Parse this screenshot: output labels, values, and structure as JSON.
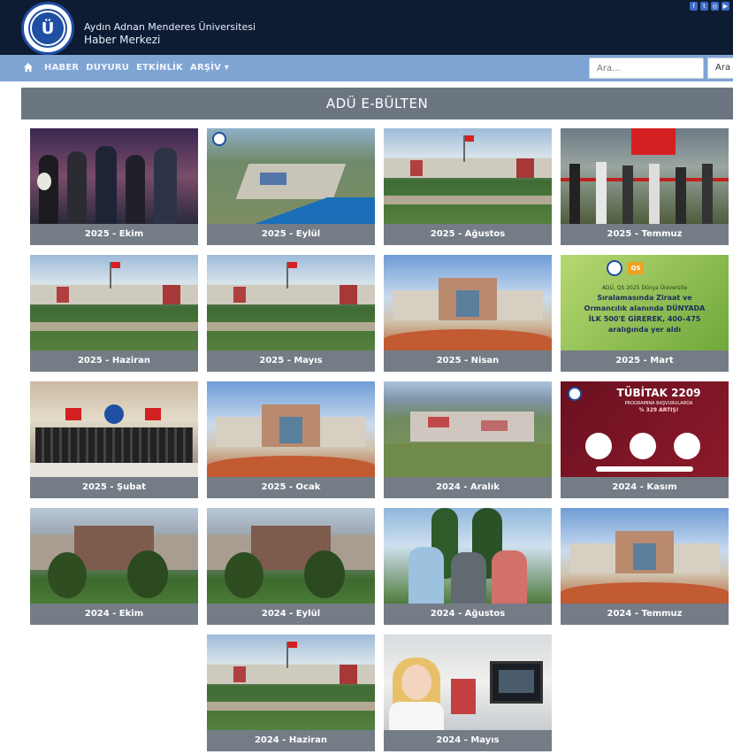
{
  "header": {
    "university": "Aydın Adnan Menderes Üniversitesi",
    "center": "Haber Merkezi",
    "logo_letter": "Ü"
  },
  "social_icons": [
    "facebook-icon",
    "twitter-icon",
    "instagram-icon",
    "youtube-icon"
  ],
  "nav": {
    "items": [
      "HABER",
      "DUYURU",
      "ETKİNLİK",
      "ARŞİV ▾"
    ]
  },
  "search": {
    "placeholder": "Ara...",
    "button": "Ara"
  },
  "page_title": "ADÜ E-BÜLTEN",
  "issues": [
    {
      "label": "2025 - Ekim",
      "scene": "people"
    },
    {
      "label": "2025 - Eylül",
      "scene": "aerial"
    },
    {
      "label": "2025 - Ağustos",
      "scene": "campus"
    },
    {
      "label": "2025 - Temmuz",
      "scene": "ribbon"
    },
    {
      "label": "2025 - Haziran",
      "scene": "campus"
    },
    {
      "label": "2025 - Mayıs",
      "scene": "campus"
    },
    {
      "label": "2025 - Nisan",
      "scene": "building"
    },
    {
      "label": "2025 - Mart",
      "scene": "qs"
    },
    {
      "label": "2025 - Şubat",
      "scene": "group"
    },
    {
      "label": "2025 - Ocak",
      "scene": "building"
    },
    {
      "label": "2024 - Aralık",
      "scene": "aerial2"
    },
    {
      "label": "2024 - Kasım",
      "scene": "tubitak"
    },
    {
      "label": "2024 - Ekim",
      "scene": "trees"
    },
    {
      "label": "2024 - Eylül",
      "scene": "trees"
    },
    {
      "label": "2024 - Ağustos",
      "scene": "three"
    },
    {
      "label": "2024 - Temmuz",
      "scene": "building"
    },
    {
      "label": "2024 - Haziran",
      "scene": "campus"
    },
    {
      "label": "2024 - Mayıs",
      "scene": "lab"
    }
  ],
  "qs_banner": {
    "badge": "QS",
    "line1": "ADÜ, QS 2025 Dünya Üniversite",
    "line2": "Sıralamasında Ziraat ve",
    "line3": "Ormancılık alanında DÜNYADA",
    "line4": "İLK 500'E GİREREK, 400–475",
    "line5": "aralığında yer aldı"
  },
  "tubitak_banner": {
    "title": "TÜBİTAK 2209",
    "sub1": "PROGRAMINA BAŞVURULARDA",
    "sub2": "% 329 ARTIŞ!"
  },
  "colors": {
    "header_bg": "#0d1b33",
    "nav_bg": "#7ea4d4",
    "card_bg": "#747c86",
    "title_bar_bg": "#6c7681"
  }
}
